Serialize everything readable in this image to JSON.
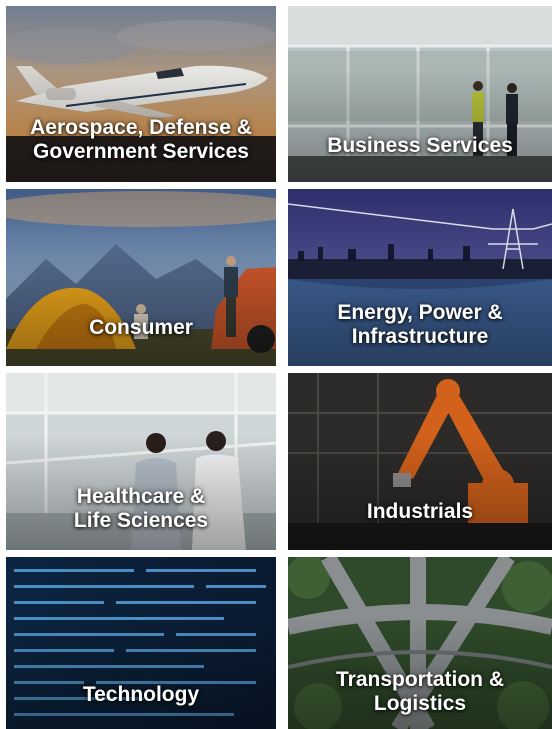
{
  "tiles": [
    {
      "key": "aerospace",
      "lines": [
        "Aerospace, Defense &",
        "Government Services"
      ]
    },
    {
      "key": "business",
      "lines": [
        "Business Services"
      ]
    },
    {
      "key": "consumer",
      "lines": [
        "Consumer"
      ]
    },
    {
      "key": "energy",
      "lines": [
        "Energy, Power &",
        "Infrastructure"
      ]
    },
    {
      "key": "healthcare",
      "lines": [
        "Healthcare &",
        "Life Sciences"
      ]
    },
    {
      "key": "industrials",
      "lines": [
        "Industrials"
      ]
    },
    {
      "key": "technology",
      "lines": [
        "Technology"
      ]
    },
    {
      "key": "transportation",
      "lines": [
        "Transportation &",
        "Logistics"
      ]
    }
  ]
}
